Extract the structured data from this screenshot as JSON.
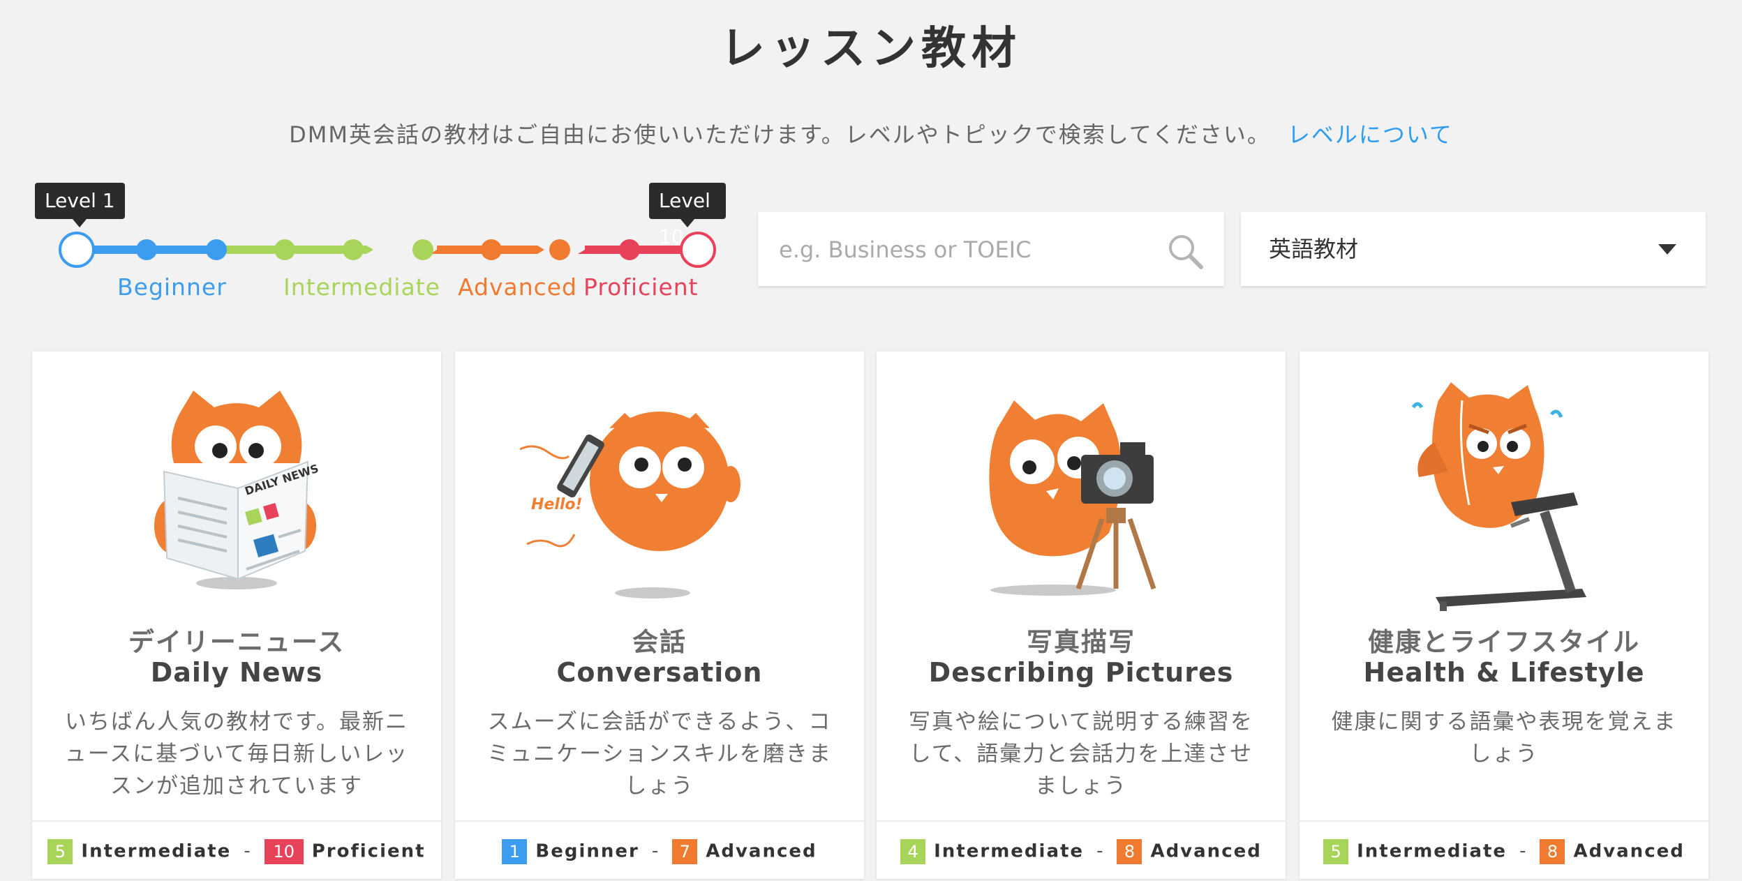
{
  "page": {
    "title": "レッスン教材",
    "subtitle": "DMM英会話の教材はご自由にお使いいただけます。レベルやトピックで検索してください。",
    "levels_link": "レベルについて"
  },
  "level_slider": {
    "min_label": "Level 1",
    "max_label": "Level 10",
    "selected_min": 1,
    "selected_max": 10,
    "bands": [
      {
        "name": "Beginner",
        "color": "#3b9cf0"
      },
      {
        "name": "Intermediate",
        "color": "#a9d45a"
      },
      {
        "name": "Advanced",
        "color": "#f07a30"
      },
      {
        "name": "Proficient",
        "color": "#e8425a"
      }
    ]
  },
  "search": {
    "placeholder": "e.g. Business or TOEIC",
    "value": ""
  },
  "material_select": {
    "value": "英語教材"
  },
  "colors": {
    "beginner": "#3b9cf0",
    "intermediate": "#a9d45a",
    "advanced": "#f07a30",
    "proficient": "#e8425a",
    "owl": "#f07f33"
  },
  "cards": [
    {
      "title_ja": "デイリーニュース",
      "title_en": "Daily News",
      "description": "いちばん人気の教材です。最新ニュースに基づいて毎日新しいレッスンが追加されています",
      "icon": "owl-reading-newspaper-icon",
      "art_text": "DAILY NEWS",
      "level_from": {
        "num": "5",
        "name": "Intermediate",
        "color": "#a9d45a"
      },
      "level_to": {
        "num": "10",
        "name": "Proficient",
        "color": "#e8425a"
      }
    },
    {
      "title_ja": "会話",
      "title_en": "Conversation",
      "description": "スムーズに会話ができるよう、コミュニケーションスキルを磨きましょう",
      "icon": "owl-phone-call-icon",
      "art_text": "Hello!",
      "level_from": {
        "num": "1",
        "name": "Beginner",
        "color": "#3b9cf0"
      },
      "level_to": {
        "num": "7",
        "name": "Advanced",
        "color": "#f07a30"
      }
    },
    {
      "title_ja": "写真描写",
      "title_en": "Describing Pictures",
      "description": "写真や絵について説明する練習をして、語彙力と会話力を上達させましょう",
      "icon": "owl-camera-icon",
      "level_from": {
        "num": "4",
        "name": "Intermediate",
        "color": "#a9d45a"
      },
      "level_to": {
        "num": "8",
        "name": "Advanced",
        "color": "#f07a30"
      }
    },
    {
      "title_ja": "健康とライフスタイル",
      "title_en": "Health & Lifestyle",
      "description": "健康に関する語彙や表現を覚えましょう",
      "icon": "owl-treadmill-icon",
      "level_from": {
        "num": "5",
        "name": "Intermediate",
        "color": "#a9d45a"
      },
      "level_to": {
        "num": "8",
        "name": "Advanced",
        "color": "#f07a30"
      }
    }
  ]
}
